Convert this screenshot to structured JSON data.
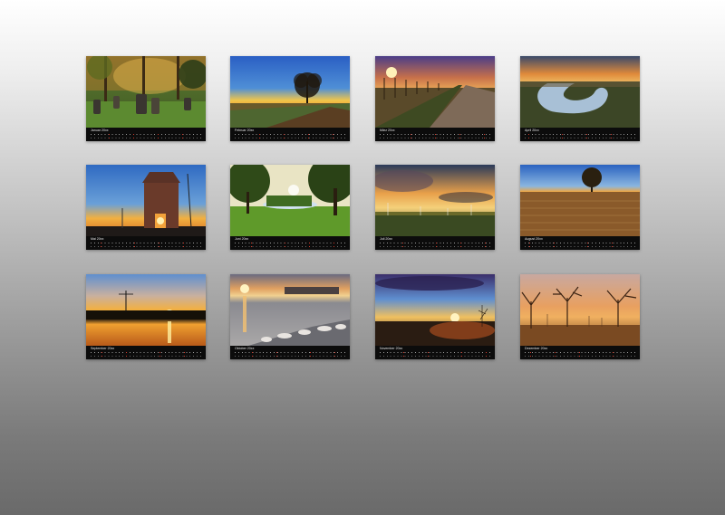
{
  "months": [
    {
      "label": "Januar 20xx",
      "scene": "cemetery"
    },
    {
      "label": "Februar 20xx",
      "scene": "lonetree"
    },
    {
      "label": "März 20xx",
      "scene": "vineyard"
    },
    {
      "label": "April 20xx",
      "scene": "riverbend"
    },
    {
      "label": "Mai 20xx",
      "scene": "tower"
    },
    {
      "label": "Juni 20xx",
      "scene": "park"
    },
    {
      "label": "Juli 20xx",
      "scene": "windfield"
    },
    {
      "label": "August 20xx",
      "scene": "wheat"
    },
    {
      "label": "September 20xx",
      "scene": "lakesunset"
    },
    {
      "label": "Oktober 20xx",
      "scene": "riverbank"
    },
    {
      "label": "November 20xx",
      "scene": "duskfield"
    },
    {
      "label": "Dezember 20xx",
      "scene": "avenue"
    }
  ]
}
